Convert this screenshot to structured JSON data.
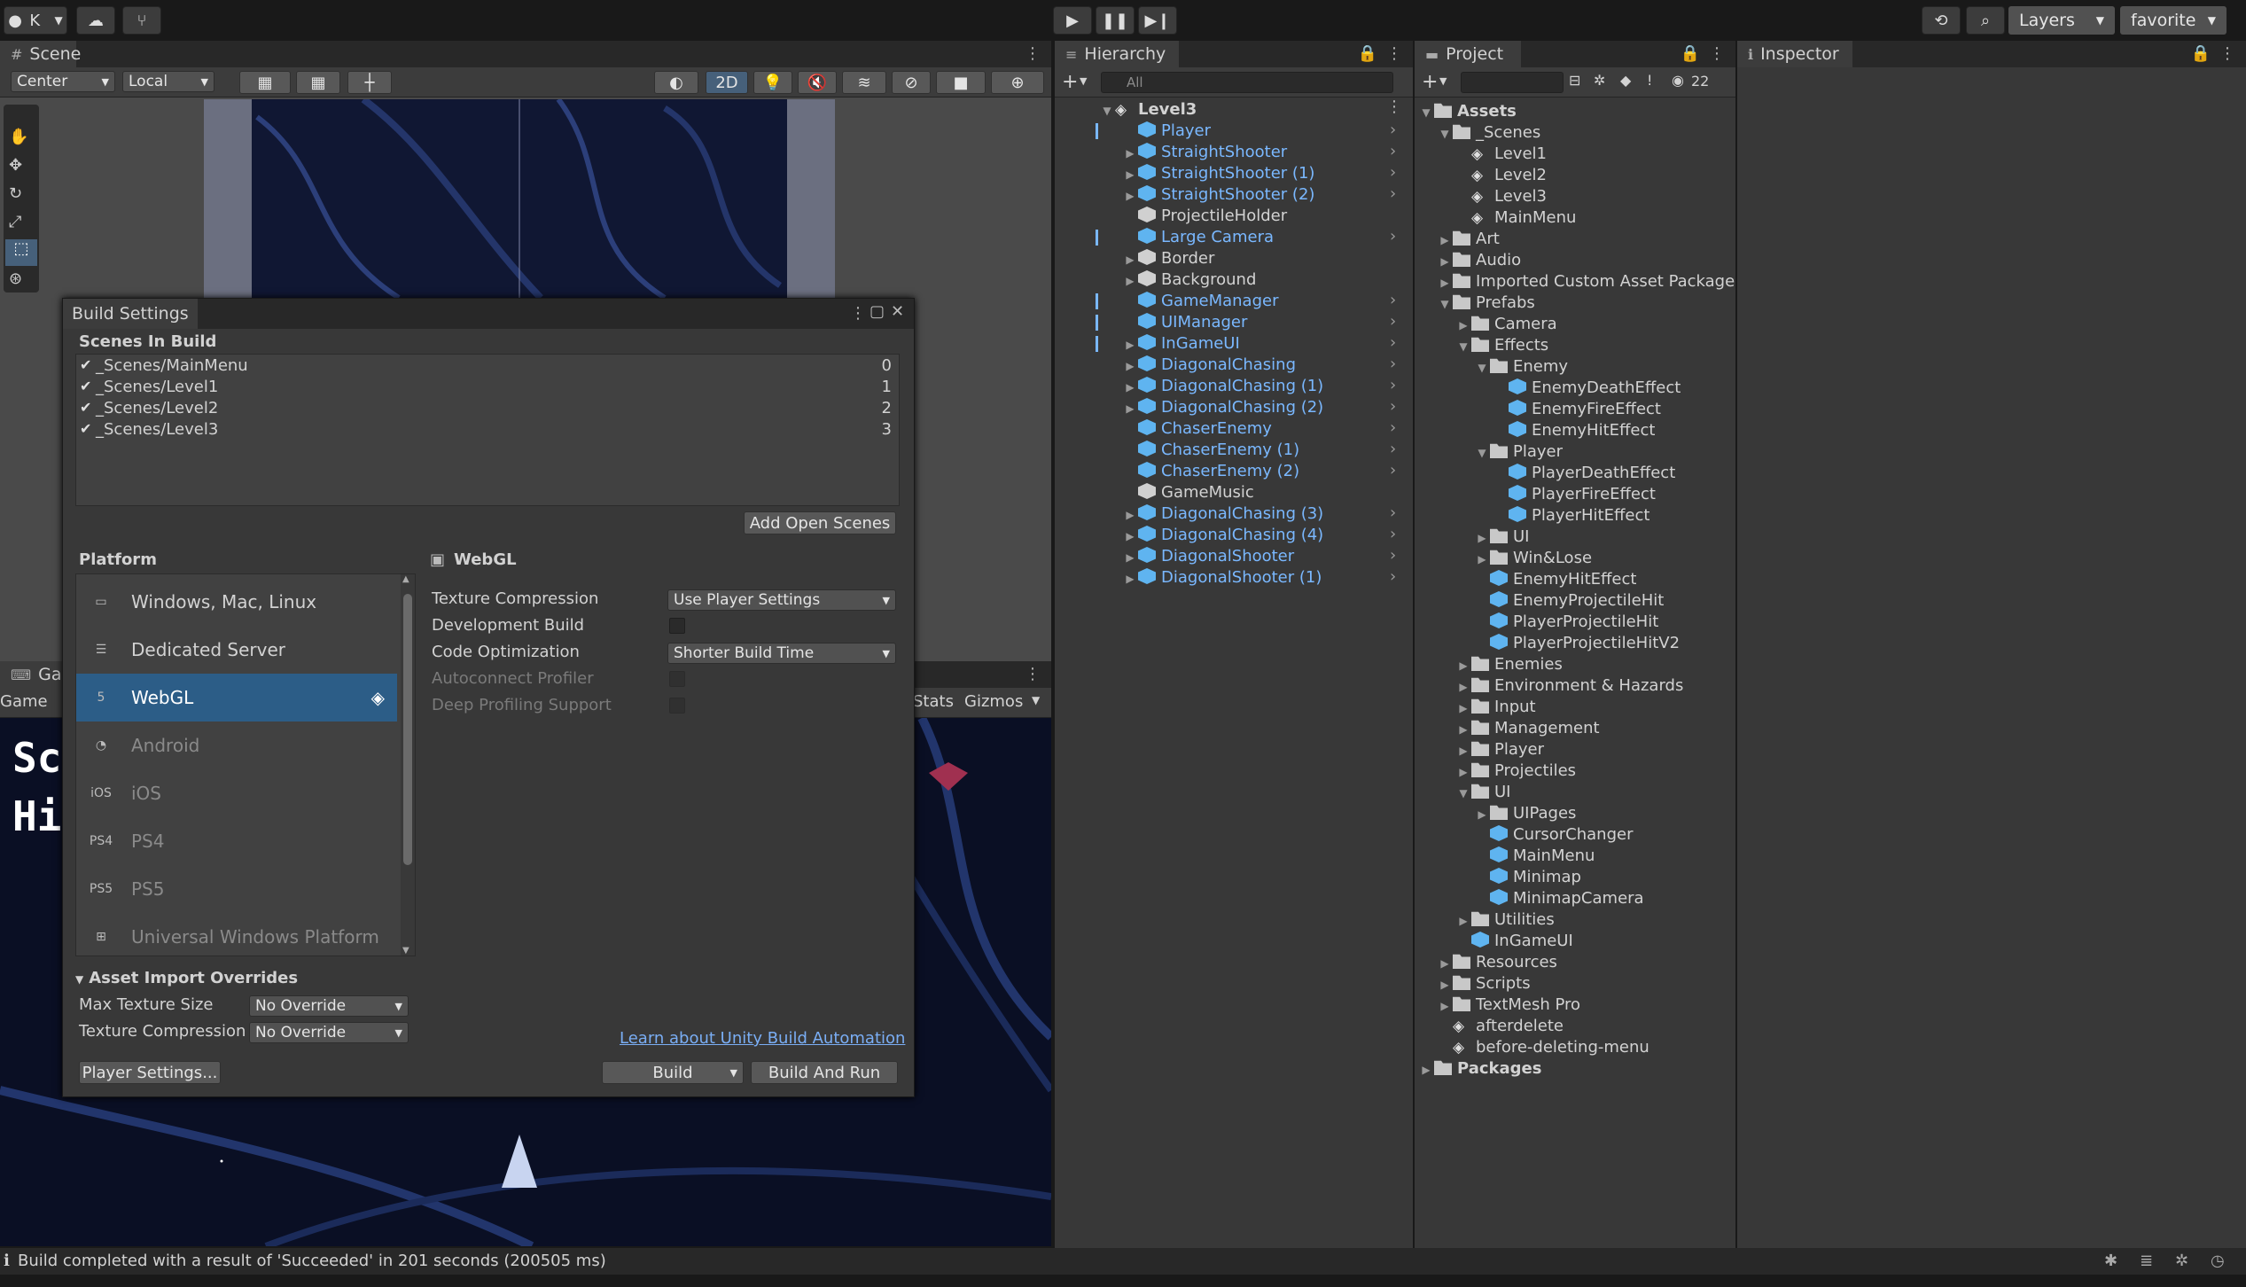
{
  "toolbar": {
    "account": "K",
    "layers": "Layers",
    "layout": "favorite"
  },
  "scene": {
    "tab": "Scene",
    "pivot": "Center",
    "space": "Local",
    "mode_2d": "2D"
  },
  "game": {
    "tab": "Game",
    "mode": "Game",
    "stats": "Stats",
    "gizmos": "Gizmos",
    "hud_line1": "Sc",
    "hud_line2": "Hi"
  },
  "hierarchy": {
    "tab": "Hierarchy",
    "search_placeholder": "All",
    "root": "Level3",
    "items": [
      {
        "label": "Player",
        "blue": true,
        "expand": false,
        "chevron": true,
        "bar": true
      },
      {
        "label": "StraightShooter",
        "blue": true,
        "expand": true,
        "chevron": true,
        "bar": false
      },
      {
        "label": "StraightShooter (1)",
        "blue": true,
        "expand": true,
        "chevron": true,
        "bar": false
      },
      {
        "label": "StraightShooter (2)",
        "blue": true,
        "expand": true,
        "chevron": true,
        "bar": false
      },
      {
        "label": "ProjectileHolder",
        "blue": false,
        "expand": false,
        "chevron": false,
        "bar": false
      },
      {
        "label": "Large Camera",
        "blue": true,
        "expand": false,
        "chevron": true,
        "bar": true
      },
      {
        "label": "Border",
        "blue": false,
        "expand": true,
        "chevron": false,
        "bar": false
      },
      {
        "label": "Background",
        "blue": false,
        "expand": true,
        "chevron": false,
        "bar": false
      },
      {
        "label": "GameManager",
        "blue": true,
        "expand": false,
        "chevron": true,
        "bar": true
      },
      {
        "label": "UIManager",
        "blue": true,
        "expand": false,
        "chevron": true,
        "bar": true
      },
      {
        "label": "InGameUI",
        "blue": true,
        "expand": true,
        "chevron": true,
        "bar": true
      },
      {
        "label": "DiagonalChasing",
        "blue": true,
        "expand": true,
        "chevron": true,
        "bar": false
      },
      {
        "label": "DiagonalChasing (1)",
        "blue": true,
        "expand": true,
        "chevron": true,
        "bar": false
      },
      {
        "label": "DiagonalChasing (2)",
        "blue": true,
        "expand": true,
        "chevron": true,
        "bar": false
      },
      {
        "label": "ChaserEnemy",
        "blue": true,
        "expand": false,
        "chevron": true,
        "bar": false
      },
      {
        "label": "ChaserEnemy (1)",
        "blue": true,
        "expand": false,
        "chevron": true,
        "bar": false
      },
      {
        "label": "ChaserEnemy (2)",
        "blue": true,
        "expand": false,
        "chevron": true,
        "bar": false
      },
      {
        "label": "GameMusic",
        "blue": false,
        "expand": false,
        "chevron": false,
        "bar": false
      },
      {
        "label": "DiagonalChasing (3)",
        "blue": true,
        "expand": true,
        "chevron": true,
        "bar": false
      },
      {
        "label": "DiagonalChasing (4)",
        "blue": true,
        "expand": true,
        "chevron": true,
        "bar": false
      },
      {
        "label": "DiagonalShooter",
        "blue": true,
        "expand": true,
        "chevron": true,
        "bar": false
      },
      {
        "label": "DiagonalShooter (1)",
        "blue": true,
        "expand": true,
        "chevron": true,
        "bar": false
      }
    ]
  },
  "project": {
    "tab": "Project",
    "count": "22",
    "tree": [
      {
        "label": "Assets",
        "depth": 0,
        "type": "folder",
        "tw": "open",
        "bold": true
      },
      {
        "label": "_Scenes",
        "depth": 1,
        "type": "folder",
        "tw": "open"
      },
      {
        "label": "Level1",
        "depth": 2,
        "type": "scene",
        "tw": ""
      },
      {
        "label": "Level2",
        "depth": 2,
        "type": "scene",
        "tw": ""
      },
      {
        "label": "Level3",
        "depth": 2,
        "type": "scene",
        "tw": ""
      },
      {
        "label": "MainMenu",
        "depth": 2,
        "type": "scene",
        "tw": ""
      },
      {
        "label": "Art",
        "depth": 1,
        "type": "folder",
        "tw": "closed"
      },
      {
        "label": "Audio",
        "depth": 1,
        "type": "folder",
        "tw": "closed"
      },
      {
        "label": "Imported Custom Asset Packages",
        "depth": 1,
        "type": "folder",
        "tw": "closed"
      },
      {
        "label": "Prefabs",
        "depth": 1,
        "type": "folder",
        "tw": "open"
      },
      {
        "label": "Camera",
        "depth": 2,
        "type": "folder",
        "tw": "closed"
      },
      {
        "label": "Effects",
        "depth": 2,
        "type": "folder",
        "tw": "open"
      },
      {
        "label": "Enemy",
        "depth": 3,
        "type": "folder",
        "tw": "open"
      },
      {
        "label": "EnemyDeathEffect",
        "depth": 4,
        "type": "prefab",
        "tw": ""
      },
      {
        "label": "EnemyFireEffect",
        "depth": 4,
        "type": "prefab",
        "tw": ""
      },
      {
        "label": "EnemyHitEffect",
        "depth": 4,
        "type": "prefab",
        "tw": ""
      },
      {
        "label": "Player",
        "depth": 3,
        "type": "folder",
        "tw": "open"
      },
      {
        "label": "PlayerDeathEffect",
        "depth": 4,
        "type": "prefab",
        "tw": ""
      },
      {
        "label": "PlayerFireEffect",
        "depth": 4,
        "type": "prefab",
        "tw": ""
      },
      {
        "label": "PlayerHitEffect",
        "depth": 4,
        "type": "prefab",
        "tw": ""
      },
      {
        "label": "UI",
        "depth": 3,
        "type": "folder",
        "tw": "closed"
      },
      {
        "label": "Win&Lose",
        "depth": 3,
        "type": "folder",
        "tw": "closed"
      },
      {
        "label": "EnemyHitEffect",
        "depth": 3,
        "type": "prefab",
        "tw": ""
      },
      {
        "label": "EnemyProjectileHit",
        "depth": 3,
        "type": "prefab",
        "tw": ""
      },
      {
        "label": "PlayerProjectileHit",
        "depth": 3,
        "type": "prefab",
        "tw": ""
      },
      {
        "label": "PlayerProjectileHitV2",
        "depth": 3,
        "type": "prefab",
        "tw": ""
      },
      {
        "label": "Enemies",
        "depth": 2,
        "type": "folder",
        "tw": "closed"
      },
      {
        "label": "Environment & Hazards",
        "depth": 2,
        "type": "folder",
        "tw": "closed"
      },
      {
        "label": "Input",
        "depth": 2,
        "type": "folder",
        "tw": "closed"
      },
      {
        "label": "Management",
        "depth": 2,
        "type": "folder",
        "tw": "closed"
      },
      {
        "label": "Player",
        "depth": 2,
        "type": "folder",
        "tw": "closed"
      },
      {
        "label": "Projectiles",
        "depth": 2,
        "type": "folder",
        "tw": "closed"
      },
      {
        "label": "UI",
        "depth": 2,
        "type": "folder",
        "tw": "open"
      },
      {
        "label": "UIPages",
        "depth": 3,
        "type": "folder",
        "tw": "closed"
      },
      {
        "label": "CursorChanger",
        "depth": 3,
        "type": "prefab",
        "tw": ""
      },
      {
        "label": "MainMenu",
        "depth": 3,
        "type": "prefab",
        "tw": ""
      },
      {
        "label": "Minimap",
        "depth": 3,
        "type": "prefab",
        "tw": ""
      },
      {
        "label": "MinimapCamera",
        "depth": 3,
        "type": "prefab",
        "tw": ""
      },
      {
        "label": "Utilities",
        "depth": 2,
        "type": "folder",
        "tw": "closed"
      },
      {
        "label": "InGameUI",
        "depth": 2,
        "type": "prefab",
        "tw": ""
      },
      {
        "label": "Resources",
        "depth": 1,
        "type": "folder",
        "tw": "closed"
      },
      {
        "label": "Scripts",
        "depth": 1,
        "type": "folder",
        "tw": "closed"
      },
      {
        "label": "TextMesh Pro",
        "depth": 1,
        "type": "folder",
        "tw": "closed"
      },
      {
        "label": "afterdelete",
        "depth": 1,
        "type": "scene",
        "tw": ""
      },
      {
        "label": "before-deleting-menu",
        "depth": 1,
        "type": "scene",
        "tw": ""
      },
      {
        "label": "Packages",
        "depth": 0,
        "type": "folder",
        "tw": "closed",
        "bold": true
      }
    ]
  },
  "inspector": {
    "tab": "Inspector"
  },
  "build_settings": {
    "title": "Build Settings",
    "scenes_header": "Scenes In Build",
    "scenes": [
      {
        "path": "_Scenes/MainMenu",
        "index": "0",
        "checked": true
      },
      {
        "path": "_Scenes/Level1",
        "index": "1",
        "checked": true
      },
      {
        "path": "_Scenes/Level2",
        "index": "2",
        "checked": true
      },
      {
        "path": "_Scenes/Level3",
        "index": "3",
        "checked": true
      }
    ],
    "add_open_scenes": "Add Open Scenes",
    "platform_header": "Platform",
    "platforms": [
      {
        "label": "Windows, Mac, Linux",
        "icon": "monitor-icon",
        "state": "normal"
      },
      {
        "label": "Dedicated Server",
        "icon": "server-icon",
        "state": "normal"
      },
      {
        "label": "WebGL",
        "icon": "html5-icon",
        "state": "selected"
      },
      {
        "label": "Android",
        "icon": "android-icon",
        "state": "dim"
      },
      {
        "label": "iOS",
        "icon": "ios-icon",
        "state": "dim"
      },
      {
        "label": "PS4",
        "icon": "ps4-icon",
        "state": "dim"
      },
      {
        "label": "PS5",
        "icon": "ps5-icon",
        "state": "dim"
      },
      {
        "label": "Universal Windows Platform",
        "icon": "windows-icon",
        "state": "dim"
      }
    ],
    "platform_title": "WebGL",
    "settings": {
      "texture_compression_label": "Texture Compression",
      "texture_compression_value": "Use Player Settings",
      "development_build_label": "Development Build",
      "code_optimization_label": "Code Optimization",
      "code_optimization_value": "Shorter Build Time",
      "autoconnect_profiler_label": "Autoconnect Profiler",
      "deep_profiling_label": "Deep Profiling Support"
    },
    "overrides": {
      "header": "Asset Import Overrides",
      "max_texture_size_label": "Max Texture Size",
      "max_texture_size_value": "No Override",
      "texture_compression_label": "Texture Compression",
      "texture_compression_value": "No Override"
    },
    "learn_link": "Learn about Unity Build Automation",
    "player_settings": "Player Settings...",
    "build": "Build",
    "build_and_run": "Build And Run"
  },
  "status": {
    "message": "Build completed with a result of 'Succeeded' in 201 seconds (200505 ms)"
  },
  "colors": {
    "accent_blue": "#7ab8ff",
    "selection": "#2c5d87",
    "panel": "#383838",
    "link": "#7aaef5"
  }
}
